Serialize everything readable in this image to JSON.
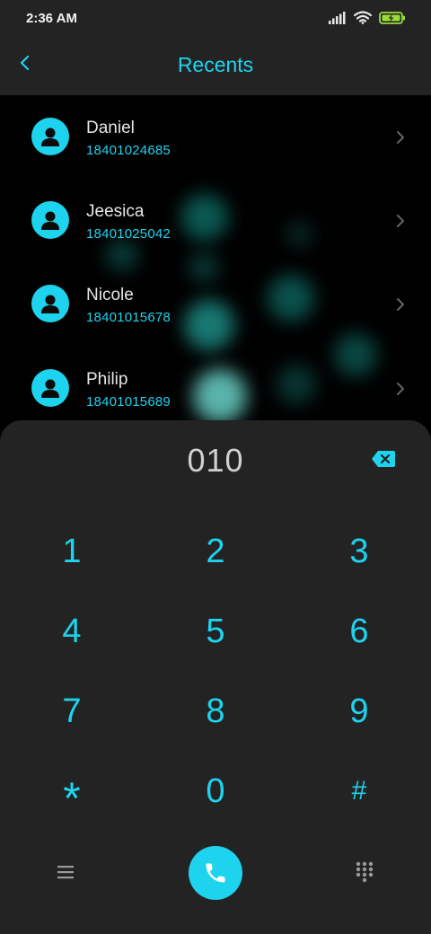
{
  "status_bar": {
    "time": "2:36 AM",
    "icons": [
      "signal-icon",
      "wifi-icon",
      "battery-charging-icon"
    ]
  },
  "header": {
    "title": "Recents",
    "back_icon": "back-arrow-icon"
  },
  "recents": [
    {
      "name": "Daniel",
      "number": "18401024685"
    },
    {
      "name": "Jeesica",
      "number": "18401025042"
    },
    {
      "name": "Nicole",
      "number": "18401015678"
    },
    {
      "name": "Philip",
      "number": "18401015689"
    }
  ],
  "dialpad": {
    "input_value": "010",
    "keys": [
      "1",
      "2",
      "3",
      "4",
      "5",
      "6",
      "7",
      "8",
      "9",
      "*",
      "0",
      "#"
    ],
    "bottom_icons": [
      "menu-icon",
      "phone-call-icon",
      "keypad-icon"
    ]
  },
  "colors": {
    "accent": "#1ed3ee",
    "surface": "#232323",
    "background": "#000000",
    "battery": "#9bdc3c"
  }
}
